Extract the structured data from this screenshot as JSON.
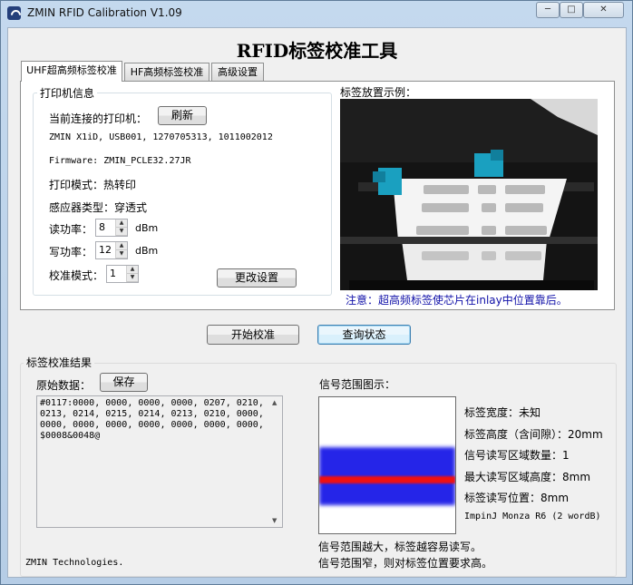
{
  "window": {
    "title": "ZMIN RFID Calibration V1.09",
    "min_glyph": "─",
    "max_glyph": "□",
    "close_glyph": "✕"
  },
  "main_title": "RFID标签校准工具",
  "tabs": [
    {
      "label": "UHF超高频标签校准",
      "active": true
    },
    {
      "label": "HF高频标签校准",
      "active": false
    },
    {
      "label": "高级设置",
      "active": false
    }
  ],
  "printer_info": {
    "group_label": "打印机信息",
    "connected_label": "当前连接的打印机：",
    "refresh_button": "刷新",
    "printer_line": "ZMIN X1iD, USB001, 1270705313, 1011002012",
    "firmware_line": "Firmware: ZMIN_PCLE32.27JR",
    "print_mode": "打印模式：热转印",
    "sensor_type": "感应器类型：穿透式",
    "read_power_label": "读功率：",
    "read_power_value": "8",
    "write_power_label": "写功率：",
    "write_power_value": "12",
    "unit": "dBm",
    "calib_mode_label": "校准模式：",
    "calib_mode_value": "1",
    "change_settings_button": "更改设置"
  },
  "example": {
    "label": "标签放置示例：",
    "note": "注意：超高频标签使芯片在inlay中位置靠后。"
  },
  "actions": {
    "start_button": "开始校准",
    "query_button": "查询状态"
  },
  "results": {
    "group_label": "标签校准结果",
    "raw_label": "原始数据：",
    "save_button": "保存",
    "raw_data": "#0117:0000, 0000, 0000, 0000, 0207, 0210, 0213, 0214, 0215, 0214, 0213, 0210, 0000, 0000, 0000, 0000, 0000, 0000, 0000, 0000, $0008&0048@",
    "signal_label": "信号范围图示：",
    "stats": [
      "标签宽度：未知",
      "标签高度（含间隙）：20mm",
      "信号读写区域数量：1",
      "最大读写区域高度：8mm",
      "标签读写位置：8mm",
      "ImpinJ Monza R6 (2 wordB)"
    ],
    "footer_note_1": "信号范围越大，标签越容易读写。",
    "footer_note_2": "信号范围窄，则对标签位置要求高。",
    "company": "ZMIN Technologies."
  },
  "colors": {
    "signal_band": "#2525e8",
    "signal_peak": "#f01010",
    "note_text": "#1010a8",
    "tag_holder": "#1aa0c0"
  }
}
